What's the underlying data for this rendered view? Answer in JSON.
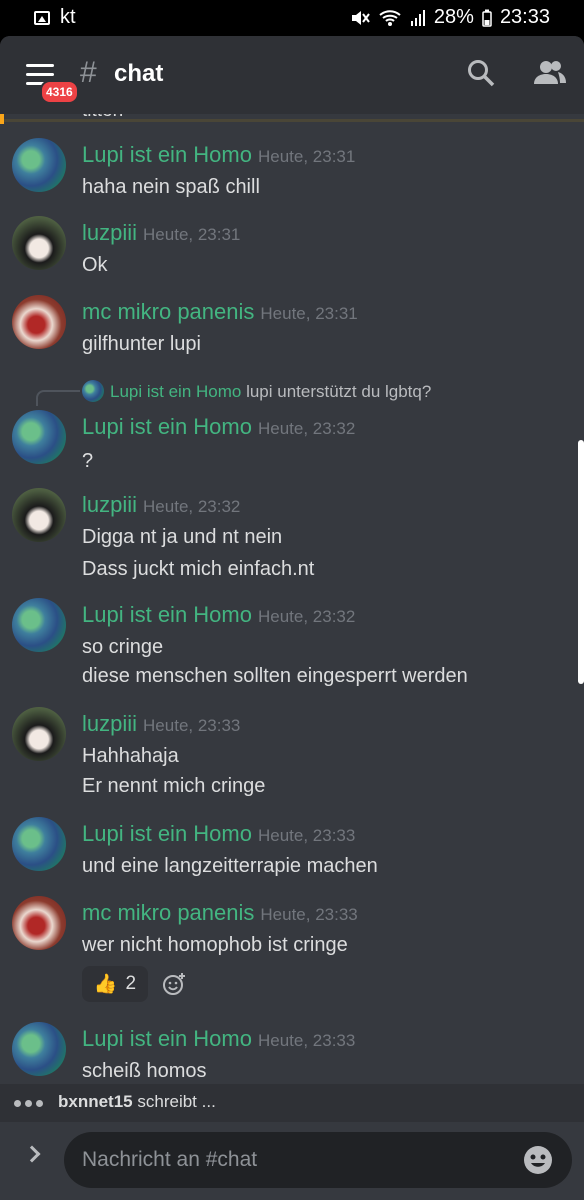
{
  "status": {
    "carrier": "kt",
    "battery": "28%",
    "time": "23:33"
  },
  "header": {
    "badge": "4316",
    "hash": "#",
    "channel": "chat"
  },
  "previous_line": "titten",
  "messages": [
    {
      "author": "Lupi ist ein Homo",
      "avatar": "lupi",
      "time": "Heute, 23:31",
      "lines": [
        "haha nein spaß chill"
      ]
    },
    {
      "author": "luzpiii",
      "avatar": "luz",
      "time": "Heute, 23:31",
      "lines": [
        "Ok"
      ]
    },
    {
      "author": "mc mikro panenis",
      "avatar": "mc",
      "time": "Heute, 23:31",
      "lines": [
        "gilfhunter lupi"
      ]
    },
    {
      "author": "Lupi ist ein Homo",
      "avatar": "lupi",
      "time": "Heute, 23:32",
      "lines": [
        "?"
      ],
      "reply": {
        "author": "Lupi ist ein Homo",
        "text": "lupi unterstützt du lgbtq?"
      }
    },
    {
      "author": "luzpiii",
      "avatar": "luz",
      "time": "Heute, 23:32",
      "lines": [
        "Digga nt ja und nt nein",
        "Dass juckt mich einfach.nt"
      ]
    },
    {
      "author": "Lupi ist ein Homo",
      "avatar": "lupi",
      "time": "Heute, 23:32",
      "lines": [
        "so cringe",
        "diese menschen sollten eingesperrt werden"
      ]
    },
    {
      "author": "luzpiii",
      "avatar": "luz",
      "time": "Heute, 23:33",
      "lines": [
        "Hahhahaja",
        "Er nennt mich cringe"
      ]
    },
    {
      "author": "Lupi ist ein Homo",
      "avatar": "lupi",
      "time": "Heute, 23:33",
      "lines": [
        "und eine langzeitterrapie machen"
      ]
    },
    {
      "author": "mc mikro panenis",
      "avatar": "mc",
      "time": "Heute, 23:33",
      "lines": [
        "wer nicht homophob ist cringe"
      ],
      "reaction": {
        "emoji": "👍",
        "count": "2"
      }
    },
    {
      "author": "Lupi ist ein Homo",
      "avatar": "lupi",
      "time": "Heute, 23:33",
      "lines": [
        "scheiß homos"
      ]
    }
  ],
  "typing": {
    "user": "bxnnet15",
    "suffix": "schreibt ..."
  },
  "composer": {
    "placeholder": "Nachricht an #chat"
  },
  "colors": {
    "background": "#36393f",
    "header": "#2f3136",
    "author": "#43b581",
    "timestamp": "#72767d"
  },
  "icons": [
    "image-icon",
    "mute-icon",
    "wifi-icon",
    "signal-icon",
    "battery-icon",
    "hamburger-icon",
    "search-icon",
    "members-icon",
    "add-reaction-icon",
    "chevron-right-icon",
    "emoji-icon"
  ]
}
